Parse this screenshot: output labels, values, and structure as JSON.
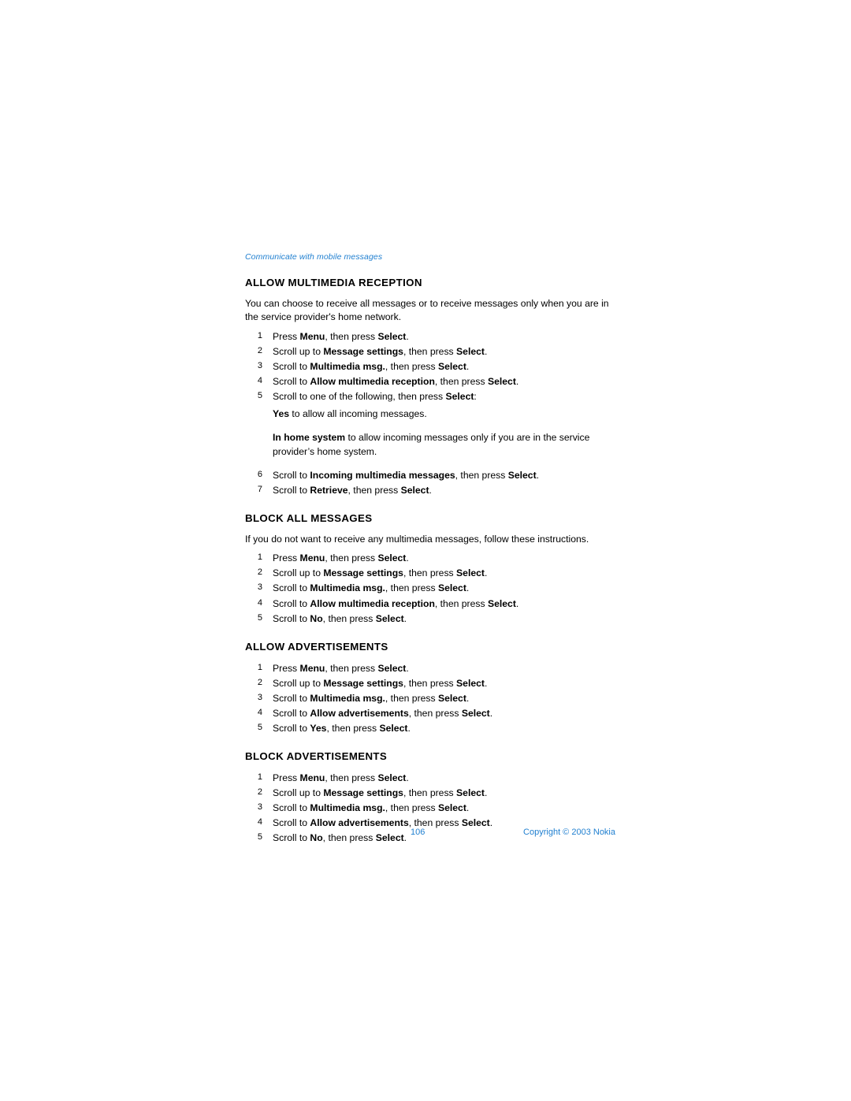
{
  "running_head": "Communicate with mobile messages",
  "footer": {
    "page_number": "106",
    "copyright": "Copyright © 2003 Nokia"
  },
  "sections": [
    {
      "title": "ALLOW MULTIMEDIA RECEPTION",
      "intro": "You can choose to receive all messages or to receive messages only when you are in the service provider's home network.",
      "steps": [
        {
          "num": "1",
          "html": "Press <b>Menu</b>, then press <b>Select</b>."
        },
        {
          "num": "2",
          "html": "Scroll up to <b>Message settings</b>, then press <b>Select</b>."
        },
        {
          "num": "3",
          "html": "Scroll to <b>Multimedia msg.</b>, then press <b>Select</b>."
        },
        {
          "num": "4",
          "html": "Scroll to <b>Allow multimedia reception</b>, then press <b>Select</b>."
        },
        {
          "num": "5",
          "html": "Scroll to one of the following, then press <b>Select</b>:"
        },
        {
          "sub": true,
          "html": "<b>Yes</b> to allow all incoming messages."
        },
        {
          "sub": true,
          "gap": true,
          "html": "<b>In home system</b> to allow incoming messages only if you are in the service provider’s home system."
        },
        {
          "num": "6",
          "html": "Scroll to <b>Incoming multimedia messages</b>, then press <b>Select</b>."
        },
        {
          "num": "7",
          "html": "Scroll to <b>Retrieve</b>, then press <b>Select</b>."
        }
      ]
    },
    {
      "title": "BLOCK ALL MESSAGES",
      "intro": "If you do not want to receive any multimedia messages, follow these instructions.",
      "steps": [
        {
          "num": "1",
          "html": "Press <b>Menu</b>, then press <b>Select</b>."
        },
        {
          "num": "2",
          "html": "Scroll up to <b>Message settings</b>, then press <b>Select</b>."
        },
        {
          "num": "3",
          "html": "Scroll to <b>Multimedia msg.</b>, then press <b>Select</b>."
        },
        {
          "num": "4",
          "html": "Scroll to <b>Allow multimedia reception</b>, then press <b>Select</b>."
        },
        {
          "num": "5",
          "html": "Scroll to <b>No</b>, then press <b>Select</b>."
        }
      ]
    },
    {
      "title": "ALLOW ADVERTISEMENTS",
      "intro": "",
      "steps": [
        {
          "num": "1",
          "html": "Press <b>Menu</b>, then press <b>Select</b>."
        },
        {
          "num": "2",
          "html": "Scroll up to <b>Message settings</b>, then press <b>Select</b>."
        },
        {
          "num": "3",
          "html": "Scroll to <b>Multimedia msg.</b>, then press <b>Select</b>."
        },
        {
          "num": "4",
          "html": "Scroll to <b>Allow advertisements</b>, then press <b>Select</b>."
        },
        {
          "num": "5",
          "html": "Scroll to <b>Yes</b>, then press <b>Select</b>."
        }
      ]
    },
    {
      "title": "BLOCK ADVERTISEMENTS",
      "intro": "",
      "steps": [
        {
          "num": "1",
          "html": "Press <b>Menu</b>, then press <b>Select</b>."
        },
        {
          "num": "2",
          "html": "Scroll up to <b>Message settings</b>, then press <b>Select</b>."
        },
        {
          "num": "3",
          "html": "Scroll to <b>Multimedia msg.</b>, then press <b>Select</b>."
        },
        {
          "num": "4",
          "html": "Scroll to <b>Allow advertisements</b>, then press <b>Select</b>."
        },
        {
          "num": "5",
          "html": "Scroll to <b>No</b>, then press <b>Select</b>."
        }
      ]
    }
  ],
  "colors": {
    "accent": "#1f7fd0",
    "text": "#000000",
    "background": "#ffffff"
  }
}
